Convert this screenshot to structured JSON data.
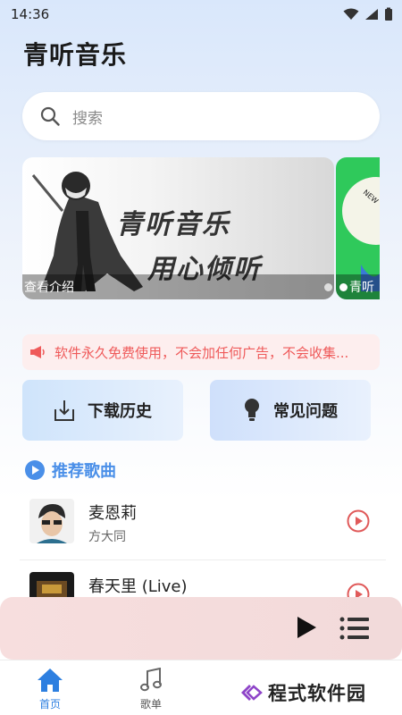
{
  "status_bar": {
    "time": "14:36"
  },
  "app": {
    "title": "青听音乐"
  },
  "search": {
    "placeholder": "搜索"
  },
  "banner": {
    "line1": "青听音乐",
    "line2": "用心倾听",
    "caption": "查看介绍",
    "next_caption": "青听"
  },
  "notice": {
    "text": "软件永久免费使用，不会加任何广告，不会收集..."
  },
  "cards": {
    "download": "下载历史",
    "faq": "常见问题"
  },
  "section": {
    "title": "推荐歌曲"
  },
  "songs": [
    {
      "title": "麦恩莉",
      "artist": "方大同"
    },
    {
      "title": "春天里 (Live)",
      "artist": ""
    }
  ],
  "nav": {
    "home": "首页",
    "playlist": "歌单"
  },
  "watermark": {
    "text": "程式软件园"
  },
  "colors": {
    "accent": "#2d7fe0",
    "notice": "#ef5a5a",
    "play": "#e05a5a"
  }
}
